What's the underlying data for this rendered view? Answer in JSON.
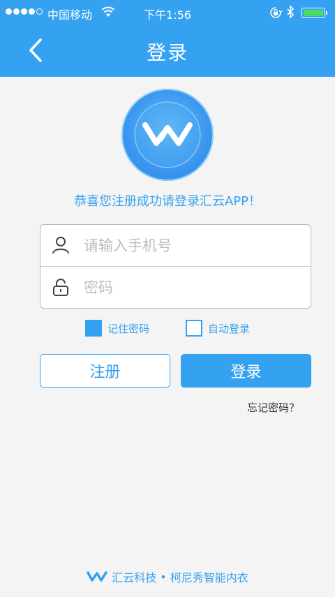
{
  "status_bar": {
    "carrier": "中国移动",
    "time": "下午1:56",
    "signal_bars": 4,
    "battery_color": "#4cd964"
  },
  "nav": {
    "title": "登录",
    "back_icon": "chevron-left-icon"
  },
  "logo": {
    "icon": "huiyun-logo-icon"
  },
  "welcome_text": "恭喜您注册成功请登录汇云APP！",
  "form": {
    "phone_placeholder": "请输入手机号",
    "phone_value": "",
    "phone_icon": "user-icon",
    "password_placeholder": "密码",
    "password_value": "",
    "password_icon": "lock-icon"
  },
  "options": {
    "remember_label": "记住密码",
    "remember_checked": true,
    "auto_login_label": "自动登录",
    "auto_login_checked": false
  },
  "buttons": {
    "register_label": "注册",
    "login_label": "登录"
  },
  "forgot_label": "忘记密码？",
  "footer": {
    "brand": "汇云科技",
    "separator": "•",
    "tagline": "柯尼秀智能内衣"
  },
  "colors": {
    "accent": "#35a2f1",
    "background": "#f4f4f4"
  }
}
